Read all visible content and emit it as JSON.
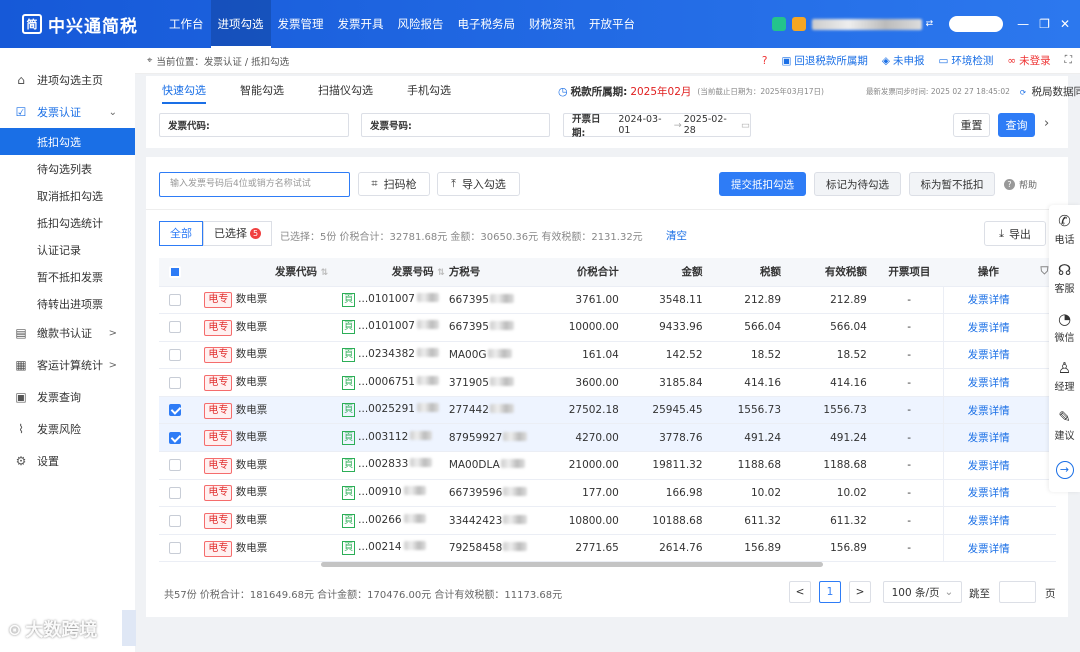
{
  "app": {
    "name": "中兴通简税",
    "logo_char": "简"
  },
  "topnav": [
    "工作台",
    "进项勾选",
    "发票管理",
    "发票开具",
    "风险报告",
    "电子税务局",
    "财税资讯",
    "开放平台"
  ],
  "topnav_active": 1,
  "sidebar": [
    {
      "label": "进项勾选主页",
      "icon": "home-icon",
      "glyph": "⌂",
      "type": "group"
    },
    {
      "label": "发票认证",
      "icon": "check-shield-icon",
      "glyph": "☑",
      "type": "group",
      "open": true,
      "arrow": "⌄"
    },
    {
      "label": "抵扣勾选",
      "type": "sub",
      "active": true
    },
    {
      "label": "待勾选列表",
      "type": "sub"
    },
    {
      "label": "取消抵扣勾选",
      "type": "sub"
    },
    {
      "label": "抵扣勾选统计",
      "type": "sub"
    },
    {
      "label": "认证记录",
      "type": "sub"
    },
    {
      "label": "暂不抵扣发票",
      "type": "sub"
    },
    {
      "label": "待转出进项票",
      "type": "sub"
    },
    {
      "label": "缴款书认证",
      "icon": "document-icon",
      "glyph": "▤",
      "type": "group",
      "arrow": ">"
    },
    {
      "label": "客运计算统计",
      "icon": "calculator-icon",
      "glyph": "▦",
      "type": "group",
      "arrow": ">"
    },
    {
      "label": "发票查询",
      "icon": "grid-icon",
      "glyph": "▣",
      "type": "group"
    },
    {
      "label": "发票风险",
      "icon": "pulse-icon",
      "glyph": "⌇",
      "type": "group"
    },
    {
      "label": "设置",
      "icon": "gear-icon",
      "glyph": "⚙",
      "type": "group"
    }
  ],
  "breadcrumb": {
    "label": "当前位置：",
    "path": "发票认证 / 抵扣勾选"
  },
  "crumb_actions": [
    "回退税款所属期",
    "未申报",
    "环境检测",
    "未登录"
  ],
  "tabs": [
    "快速勾选",
    "智能勾选",
    "扫描仪勾选",
    "手机勾选"
  ],
  "period": {
    "label": "税款所属期:",
    "value": "2025年02月",
    "deadline": "(当前截止日期为：2025年03月17日)",
    "update": "最新发票同步时间: 2025 02 27 18:45:02",
    "sync": "税局数据同步"
  },
  "filters": {
    "code_label": "发票代码:",
    "number_label": "发票号码:",
    "date_label": "开票日期:",
    "date_from": "2024-03-01",
    "date_sep": "→",
    "date_to": "2025-02-28"
  },
  "buttons": {
    "reset": "重置",
    "query": "查询",
    "scanner": "扫码枪",
    "import": "导入勾选",
    "submit": "提交抵扣勾选",
    "mark_pending": "标记为待勾选",
    "mark_hold": "标为暂不抵扣",
    "help": "帮助",
    "export": "导出",
    "clear": "清空"
  },
  "search": {
    "placeholder": "输入发票号码后4位或销方名称试试"
  },
  "segment": {
    "all": "全部",
    "selected": "已选择",
    "selected_count": "5"
  },
  "selection_summary": "已选择：5份 价税合计：32781.68元 金额：30650.36元 有效税额：2131.32元",
  "table": {
    "headers": [
      "发票代码",
      "发票号码",
      "方税号",
      "价税合计",
      "金额",
      "税额",
      "有效税额",
      "开票项目",
      "操作"
    ],
    "rows": [
      {
        "type": "电专",
        "kind": "数电票",
        "num": "...0101007",
        "tax": "667395",
        "total": "3761.00",
        "amount": "3548.11",
        "taxamt": "212.89",
        "valid": "212.89",
        "item": "-",
        "action": "发票详情",
        "checked": false
      },
      {
        "type": "电专",
        "kind": "数电票",
        "num": "...0101007",
        "tax": "667395",
        "total": "10000.00",
        "amount": "9433.96",
        "taxamt": "566.04",
        "valid": "566.04",
        "item": "-",
        "action": "发票详情",
        "checked": false
      },
      {
        "type": "电专",
        "kind": "数电票",
        "num": "...0234382",
        "tax": "MA00G",
        "total": "161.04",
        "amount": "142.52",
        "taxamt": "18.52",
        "valid": "18.52",
        "item": "-",
        "action": "发票详情",
        "checked": false
      },
      {
        "type": "电专",
        "kind": "数电票",
        "num": "...0006751",
        "tax": "371905",
        "total": "3600.00",
        "amount": "3185.84",
        "taxamt": "414.16",
        "valid": "414.16",
        "item": "-",
        "action": "发票详情",
        "checked": false
      },
      {
        "type": "电专",
        "kind": "数电票",
        "num": "...0025291",
        "tax": "277442",
        "total": "27502.18",
        "amount": "25945.45",
        "taxamt": "1556.73",
        "valid": "1556.73",
        "item": "-",
        "action": "发票详情",
        "checked": true
      },
      {
        "type": "电专",
        "kind": "数电票",
        "num": "...003112",
        "tax": "87959927",
        "total": "4270.00",
        "amount": "3778.76",
        "taxamt": "491.24",
        "valid": "491.24",
        "item": "-",
        "action": "发票详情",
        "checked": true
      },
      {
        "type": "电专",
        "kind": "数电票",
        "num": "...002833",
        "tax": "MA00DLA",
        "total": "21000.00",
        "amount": "19811.32",
        "taxamt": "1188.68",
        "valid": "1188.68",
        "item": "-",
        "action": "发票详情",
        "checked": false
      },
      {
        "type": "电专",
        "kind": "数电票",
        "num": "...00910",
        "tax": "66739596",
        "total": "177.00",
        "amount": "166.98",
        "taxamt": "10.02",
        "valid": "10.02",
        "item": "-",
        "action": "发票详情",
        "checked": false
      },
      {
        "type": "电专",
        "kind": "数电票",
        "num": "...00266",
        "tax": "33442423",
        "total": "10800.00",
        "amount": "10188.68",
        "taxamt": "611.32",
        "valid": "611.32",
        "item": "-",
        "action": "发票详情",
        "checked": false
      },
      {
        "type": "电专",
        "kind": "数电票",
        "num": "...00214",
        "tax": "79258458",
        "total": "2771.65",
        "amount": "2614.76",
        "taxamt": "156.89",
        "valid": "156.89",
        "item": "-",
        "action": "发票详情",
        "checked": false
      }
    ]
  },
  "footer_summary": "共57份 价税合计：181649.68元 合计金额：170476.00元 合计有效税额：11173.68元",
  "pagination": {
    "current": "1",
    "page_size": "100 条/页",
    "goto_label": "跳至",
    "page_label": "页",
    "prev": "<",
    "next": ">"
  },
  "rightbar": [
    {
      "label": "电话",
      "icon": "phone-icon",
      "glyph": "✆"
    },
    {
      "label": "客服",
      "icon": "headset-icon",
      "glyph": "☊"
    },
    {
      "label": "微信",
      "icon": "wechat-icon",
      "glyph": "◔"
    },
    {
      "label": "经理",
      "icon": "person-icon",
      "glyph": "♙"
    },
    {
      "label": "建议",
      "icon": "edit-icon",
      "glyph": "✎"
    }
  ],
  "watermark": "大数跨境"
}
